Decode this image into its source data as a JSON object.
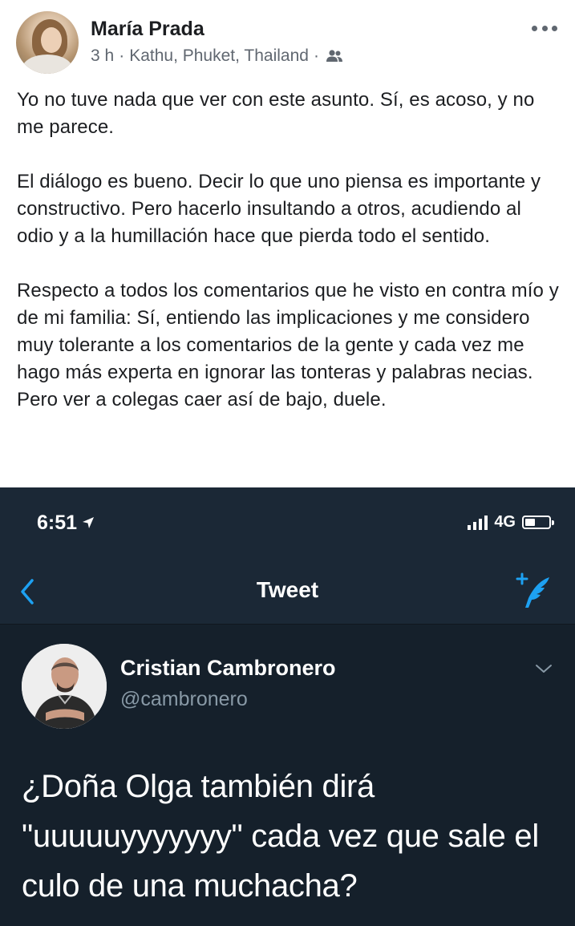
{
  "post": {
    "author_name": "María Prada",
    "time": "3 h",
    "separator": "·",
    "location": "Kathu, Phuket, Thailand",
    "audience_icon": "friends-icon",
    "more_icon": "more-options-icon",
    "paragraphs": [
      "Yo no tuve nada que ver con este asunto. Sí, es acoso, y no me parece.",
      "El diálogo es bueno. Decir lo que uno piensa es importante y constructivo. Pero hacerlo insultando a otros, acudiendo al odio y a la humillación hace que pierda todo el sentido.",
      "Respecto a todos los comentarios que he visto en contra mío y de mi familia: Sí, entiendo las implicaciones y me considero muy tolerante a los comentarios de la gente y cada vez me hago más experta en ignorar las tonteras y palabras necias. Pero ver a colegas caer así de bajo, duele."
    ]
  },
  "screenshot": {
    "status_bar": {
      "time": "6:51",
      "location_icon": "location-arrow-icon",
      "network": "4G",
      "signal_icon": "signal-bars-icon",
      "battery_icon": "battery-icon"
    },
    "nav": {
      "title": "Tweet",
      "back_icon": "back-chevron-icon",
      "compose_icon": "compose-tweet-icon"
    },
    "tweet": {
      "name": "Cristian Cambronero",
      "handle": "@cambronero",
      "text": "¿Doña Olga también dirá \"uuuuuyyyyyyy\" cada vez que sale el culo de una muchacha?",
      "menu_icon": "chevron-down-icon"
    },
    "colors": {
      "background": "#15202b",
      "bar": "#1b2836",
      "accent": "#1da1f2",
      "muted": "#8899a6"
    }
  }
}
